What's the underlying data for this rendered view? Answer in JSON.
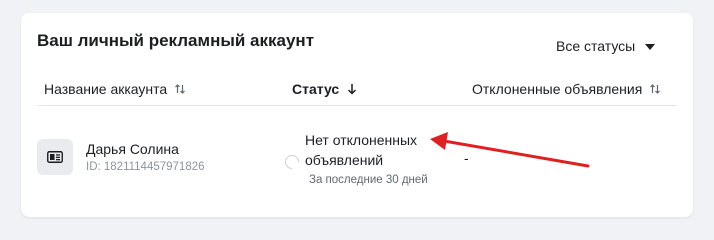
{
  "card": {
    "title": "Ваш личный рекламный аккаунт",
    "status_filter": "Все статусы"
  },
  "table": {
    "columns": [
      {
        "label": "Название аккаунта",
        "sort": "both"
      },
      {
        "label": "Статус",
        "sort": "desc"
      },
      {
        "label": "Отклоненные объявления",
        "sort": "both"
      }
    ],
    "rows": [
      {
        "account_name": "Дарья Солина",
        "account_id": "ID: 1821114457971826",
        "status_line1": "Нет отклоненных",
        "status_line2": "объявлений",
        "status_sub": "За последние 30 дней",
        "rejected": "-"
      }
    ]
  },
  "icons": {
    "sort_both": "sort-arrows-icon",
    "sort_desc": "arrow-down-icon",
    "filter_caret": "caret-down-icon",
    "account_avatar": "ad-account-icon",
    "status_indicator": "loading-circle-icon"
  },
  "colors": {
    "background": "#f0f2f5",
    "card": "#ffffff",
    "text": "#1c1e21",
    "muted": "#8d949e",
    "annotation_arrow": "#e02020"
  }
}
